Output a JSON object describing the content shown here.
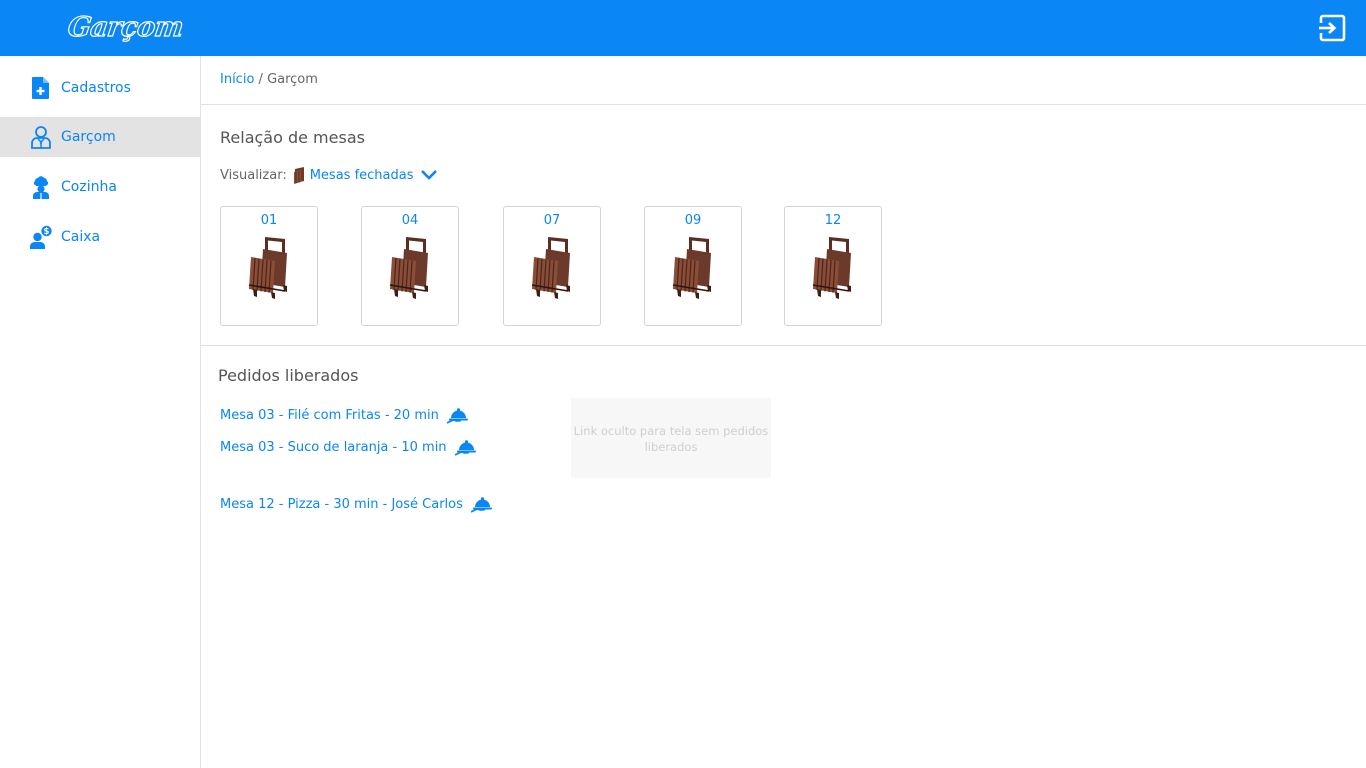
{
  "header": {
    "logo_text": "Garçom",
    "logout_icon": "logout-icon"
  },
  "sidebar": {
    "items": [
      {
        "label": "Cadastros",
        "icon": "add-document-icon",
        "active": false
      },
      {
        "label": "Garçom",
        "icon": "waiter-icon",
        "active": true
      },
      {
        "label": "Cozinha",
        "icon": "chef-icon",
        "active": false
      },
      {
        "label": "Caixa",
        "icon": "cashier-icon",
        "active": false
      }
    ]
  },
  "breadcrumb": {
    "home": "Início",
    "separator": " / ",
    "current": "Garçom"
  },
  "tables_section": {
    "title": "Relação de mesas",
    "view_label": "Visualizar:",
    "view_selected": "Mesas fechadas",
    "tables": [
      {
        "number": "01"
      },
      {
        "number": "04"
      },
      {
        "number": "07"
      },
      {
        "number": "09"
      },
      {
        "number": "12"
      }
    ]
  },
  "orders_section": {
    "title": "Pedidos liberados",
    "orders": [
      {
        "text": "Mesa 03 - Filé com Fritas - 20 min"
      },
      {
        "text": "Mesa 03 - Suco de laranja - 10 min"
      },
      {
        "text": "Mesa 12 - Pizza - 30 min - José Carlos"
      }
    ],
    "hidden_link_text": "Link oculto para tela sem pedidos liberados"
  },
  "colors": {
    "brand": "#0a86f5",
    "active_nav": "#e3e3e3",
    "table_wood": "#6b3a2a"
  }
}
